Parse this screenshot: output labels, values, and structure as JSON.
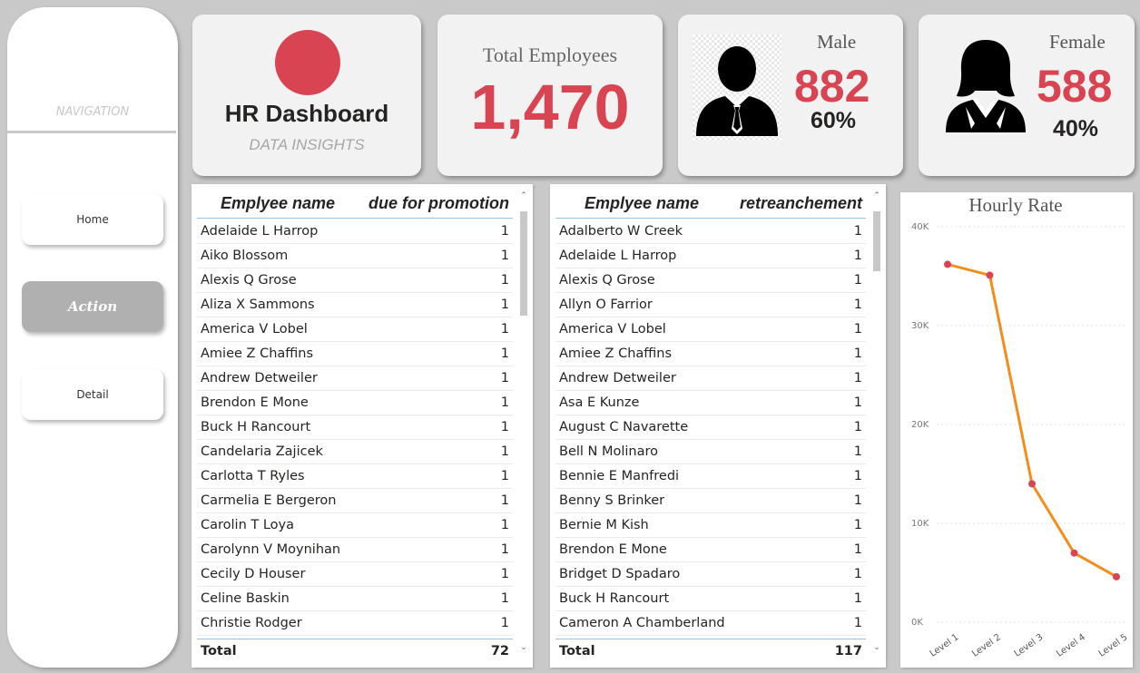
{
  "navigation": {
    "title": "NAVIGATION",
    "buttons": [
      {
        "label": "Home",
        "active": false
      },
      {
        "label": "Action",
        "active": true
      },
      {
        "label": "Detail",
        "active": false
      }
    ]
  },
  "header": {
    "title": "HR Dashboard",
    "subtitle": "DATA INSIGHTS",
    "accent_color": "#d94452"
  },
  "total_employees": {
    "label": "Total Employees",
    "value": "1,470"
  },
  "male": {
    "label": "Male",
    "value": "882",
    "percent": "60%"
  },
  "female": {
    "label": "Female",
    "value": "588",
    "percent": "40%"
  },
  "promotion_table": {
    "col1": "Emplyee name",
    "col2": "due for promotion",
    "rows": [
      {
        "name": "Adelaide L Harrop",
        "count": "1"
      },
      {
        "name": "Aiko Blossom",
        "count": "1"
      },
      {
        "name": "Alexis Q Grose",
        "count": "1"
      },
      {
        "name": "Aliza X Sammons",
        "count": "1"
      },
      {
        "name": "America V Lobel",
        "count": "1"
      },
      {
        "name": "Amiee Z Chaffins",
        "count": "1"
      },
      {
        "name": "Andrew Detweiler",
        "count": "1"
      },
      {
        "name": "Brendon E Mone",
        "count": "1"
      },
      {
        "name": "Buck H Rancourt",
        "count": "1"
      },
      {
        "name": "Candelaria Zajicek",
        "count": "1"
      },
      {
        "name": "Carlotta T Ryles",
        "count": "1"
      },
      {
        "name": "Carmelia E Bergeron",
        "count": "1"
      },
      {
        "name": "Carolin T Loya",
        "count": "1"
      },
      {
        "name": "Carolynn V Moynihan",
        "count": "1"
      },
      {
        "name": "Cecily D Houser",
        "count": "1"
      },
      {
        "name": "Celine Baskin",
        "count": "1"
      },
      {
        "name": "Christie Rodger",
        "count": "1"
      }
    ],
    "total_label": "Total",
    "total_value": "72"
  },
  "retrenchment_table": {
    "col1": "Emplyee name",
    "col2": "retreanchement",
    "rows": [
      {
        "name": "Adalberto W Creek",
        "count": "1"
      },
      {
        "name": "Adelaide L Harrop",
        "count": "1"
      },
      {
        "name": "Alexis Q Grose",
        "count": "1"
      },
      {
        "name": "Allyn O Farrior",
        "count": "1"
      },
      {
        "name": "America V Lobel",
        "count": "1"
      },
      {
        "name": "Amiee Z Chaffins",
        "count": "1"
      },
      {
        "name": "Andrew Detweiler",
        "count": "1"
      },
      {
        "name": "Asa E Kunze",
        "count": "1"
      },
      {
        "name": "August C Navarette",
        "count": "1"
      },
      {
        "name": "Bell N Molinaro",
        "count": "1"
      },
      {
        "name": "Bennie E Manfredi",
        "count": "1"
      },
      {
        "name": "Benny S Brinker",
        "count": "1"
      },
      {
        "name": "Bernie M Kish",
        "count": "1"
      },
      {
        "name": "Brendon E Mone",
        "count": "1"
      },
      {
        "name": "Bridget D Spadaro",
        "count": "1"
      },
      {
        "name": "Buck H Rancourt",
        "count": "1"
      },
      {
        "name": "Cameron A Chamberland",
        "count": "1"
      }
    ],
    "total_label": "Total",
    "total_value": "117"
  },
  "chart_data": {
    "type": "line",
    "title": "Hourly Rate",
    "categories": [
      "Level 1",
      "Level 2",
      "Level 3",
      "Level 4",
      "Level 5"
    ],
    "series": [
      {
        "values": [
          36200,
          35100,
          14000,
          7000,
          4600
        ],
        "line_color": "#f28e1c",
        "marker_color": "#d94452"
      }
    ],
    "yticks": [
      "0K",
      "10K",
      "20K",
      "30K",
      "40K"
    ],
    "ylim": [
      0,
      40000
    ],
    "grid": true
  }
}
